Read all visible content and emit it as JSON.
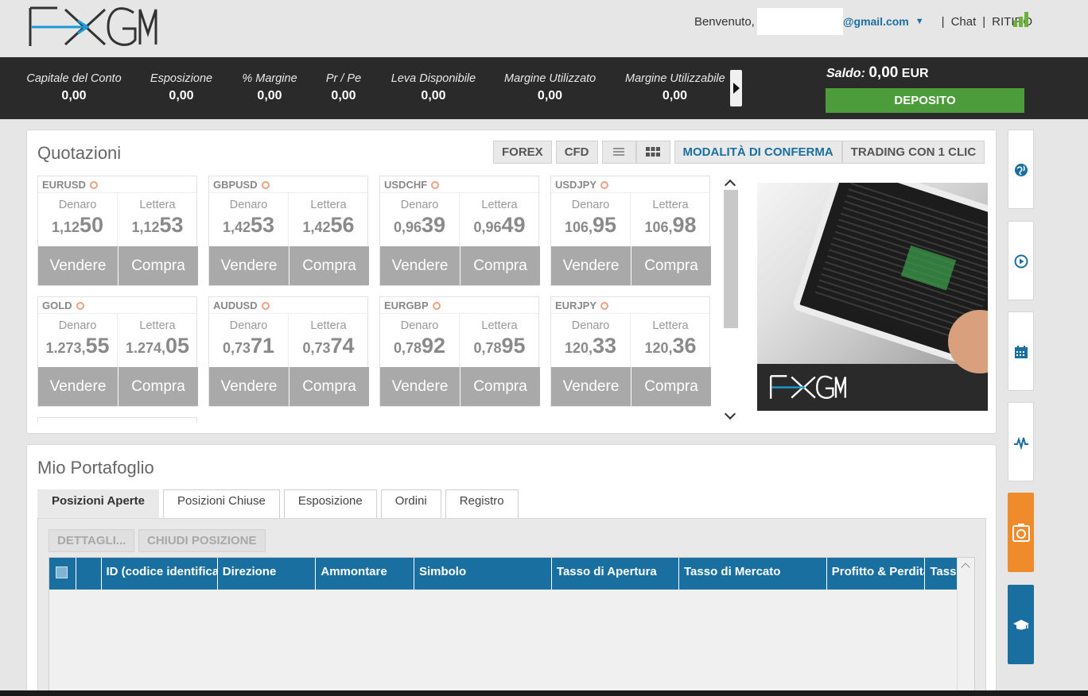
{
  "header": {
    "welcome": "Benvenuto,",
    "email_suffix": "@gmail.com",
    "chat": "Chat",
    "withdraw": "RITIRO",
    "separator": "|"
  },
  "account": {
    "metrics": [
      {
        "label": "Capitale del Conto",
        "value": "0,00"
      },
      {
        "label": "Esposizione",
        "value": "0,00"
      },
      {
        "label": "% Margine",
        "value": "0,00"
      },
      {
        "label": "Pr / Pe",
        "value": "0,00"
      },
      {
        "label": "Leva Disponibile",
        "value": "0,00"
      },
      {
        "label": "Margine Utilizzato",
        "value": "0,00"
      },
      {
        "label": "Margine Utilizzabile",
        "value": "0,00"
      }
    ],
    "saldo_label": "Saldo:",
    "saldo_value": "0,00",
    "saldo_currency": "EUR",
    "deposit": "DEPOSITO"
  },
  "quotes": {
    "title": "Quotazioni",
    "filters": [
      "FOREX",
      "CFD"
    ],
    "mode_confirm": "MODALITÀ DI CONFERMA",
    "mode_one_click": "TRADING CON 1 CLIC",
    "bid_label": "Denaro",
    "ask_label": "Lettera",
    "sell": "Vendere",
    "buy": "Compra",
    "cards": [
      {
        "symbol": "EURUSD",
        "bid_small": "1,12",
        "bid_big": "50",
        "ask_small": "1,12",
        "ask_big": "53"
      },
      {
        "symbol": "GBPUSD",
        "bid_small": "1,42",
        "bid_big": "53",
        "ask_small": "1,42",
        "ask_big": "56"
      },
      {
        "symbol": "USDCHF",
        "bid_small": "0,96",
        "bid_big": "39",
        "ask_small": "0,96",
        "ask_big": "49"
      },
      {
        "symbol": "USDJPY",
        "bid_small": "106,",
        "bid_big": "95",
        "ask_small": "106,",
        "ask_big": "98"
      },
      {
        "symbol": "GOLD",
        "bid_small": "1.273,",
        "bid_big": "55",
        "ask_small": "1.274,",
        "ask_big": "05"
      },
      {
        "symbol": "AUDUSD",
        "bid_small": "0,73",
        "bid_big": "71",
        "ask_small": "0,73",
        "ask_big": "74"
      },
      {
        "symbol": "EURGBP",
        "bid_small": "0,78",
        "bid_big": "92",
        "ask_small": "0,78",
        "ask_big": "95"
      },
      {
        "symbol": "EURJPY",
        "bid_small": "120,",
        "bid_big": "33",
        "ask_small": "120,",
        "ask_big": "36"
      }
    ]
  },
  "portfolio": {
    "title": "Mio Portafoglio",
    "tabs": [
      "Posizioni Aperte",
      "Posizioni Chiuse",
      "Esposizione",
      "Ordini",
      "Registro"
    ],
    "details_button": "DETTAGLI...",
    "close_button": "CHIUDI POSIZIONE",
    "columns": [
      "ID (codice identificativo)",
      "Direzione",
      "Ammontare",
      "Simbolo",
      "Tasso di Apertura",
      "Tasso di Mercato",
      "Profitto & Perdita",
      "Tasso"
    ]
  },
  "sidebar": {
    "icons": [
      "globe-icon",
      "play-icon",
      "calendar-icon",
      "pulse-icon",
      "camera-icon",
      "graduation-cap-icon"
    ]
  },
  "colors": {
    "brand_blue": "#1a6fa1",
    "deposit_green": "#4c9c3c",
    "accent_orange": "#f08b2c",
    "dark_strip": "#2a2a2a"
  }
}
